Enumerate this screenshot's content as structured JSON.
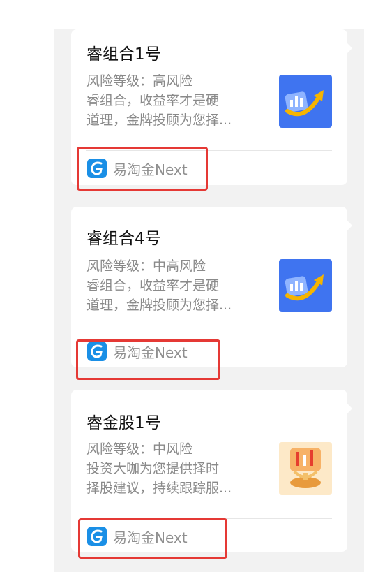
{
  "cards": [
    {
      "title": "睿组合1号",
      "desc_line1": "风险等级：高风险",
      "desc_line2": "睿组合，收益率才是硬",
      "desc_line3": "道理，金牌投顾为您择...",
      "thumb_icon": "chart-arrow-icon",
      "source_icon": "yitaojin-logo-icon",
      "source_label": "易淘金Next"
    },
    {
      "title": "睿组合4号",
      "desc_line1": "风险等级：中高风险",
      "desc_line2": "睿组合，收益率才是硬",
      "desc_line3": "道理，金牌投顾为您择...",
      "thumb_icon": "chart-arrow-icon",
      "source_icon": "yitaojin-logo-icon",
      "source_label": "易淘金Next"
    },
    {
      "title": "睿金股1号",
      "desc_line1": "风险等级：中风险",
      "desc_line2": "投资大咖为您提供择时",
      "desc_line3": "择股建议，持续跟踪服...",
      "thumb_icon": "candlestick-trophy-icon",
      "source_icon": "yitaojin-logo-icon",
      "source_label": "易淘金Next"
    }
  ],
  "colors": {
    "background": "#f2f2f2",
    "card": "#ffffff",
    "highlight": "#e53935",
    "thumb_blue": "#3f74f0",
    "logo_blue": "#1a8fe6"
  }
}
